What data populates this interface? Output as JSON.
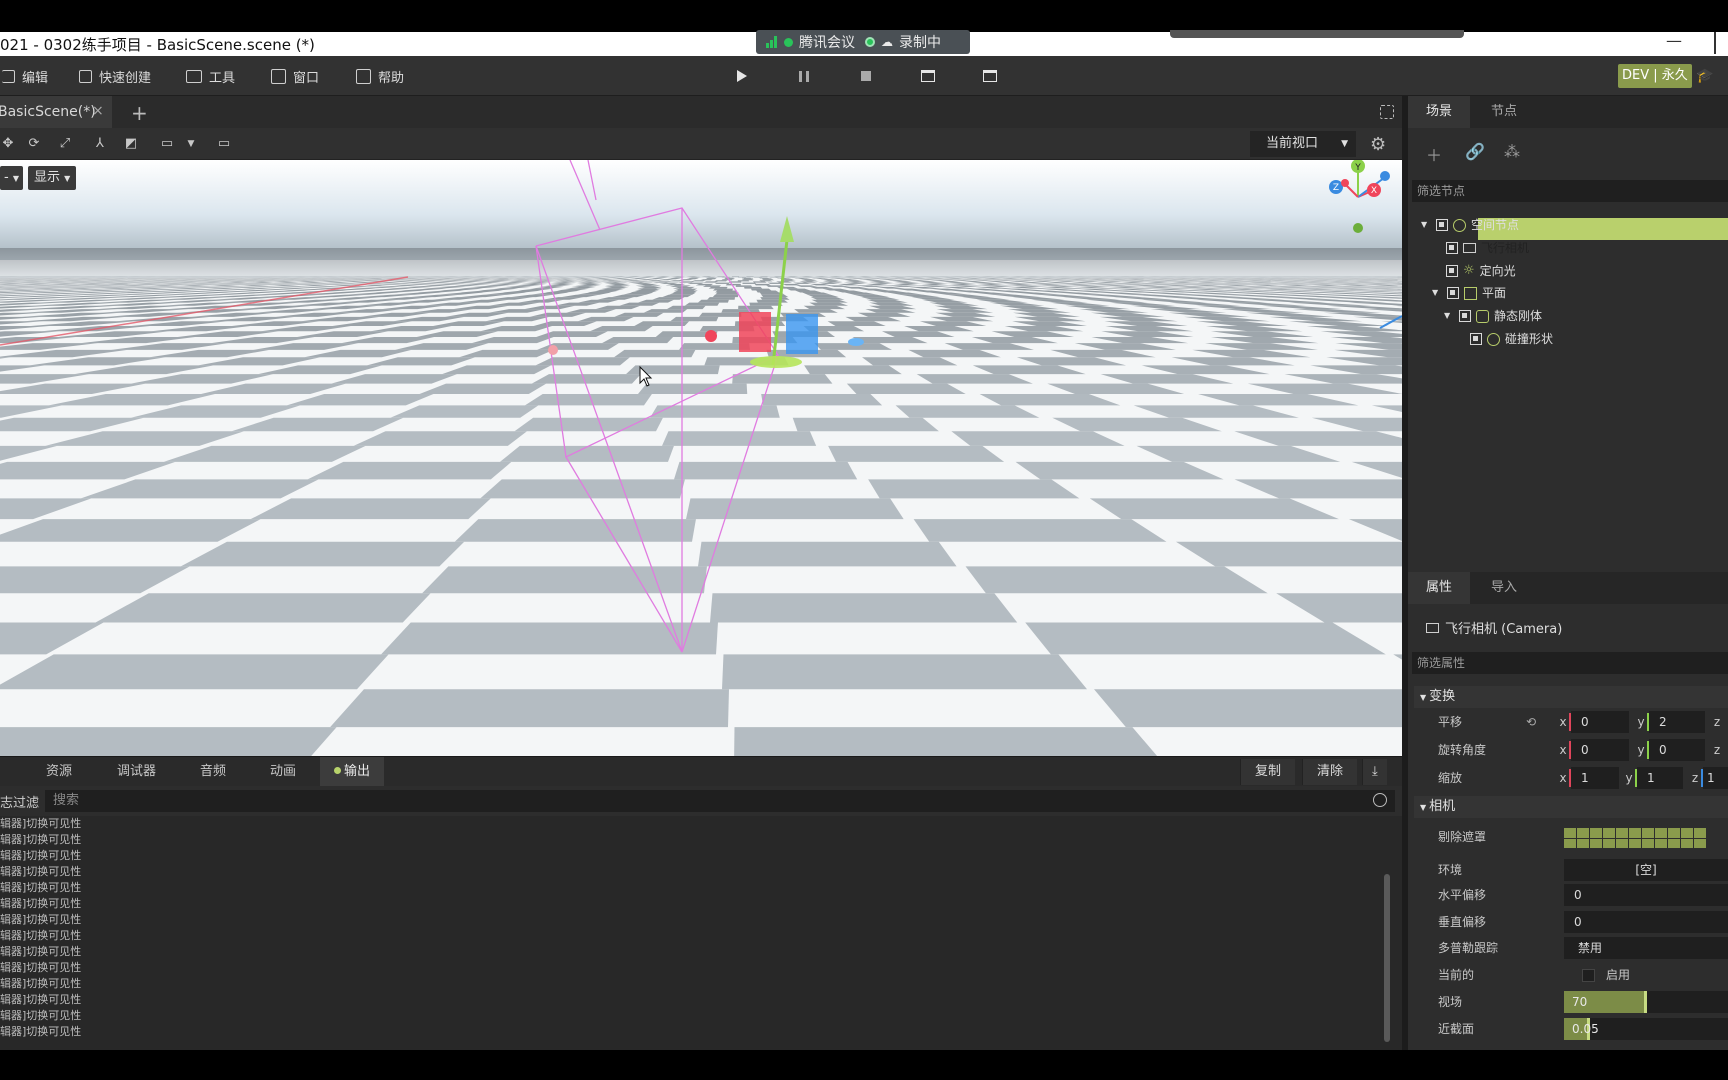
{
  "window": {
    "title": "021 - 0302练手项目 - BasicScene.scene (*)"
  },
  "meeting": {
    "app": "腾讯会议",
    "recording": "录制中"
  },
  "menu": {
    "items": [
      "编辑",
      "快速创建",
      "工具",
      "窗口",
      "帮助"
    ]
  },
  "badge": "DEV | 永久",
  "document_tab": {
    "label": "BasicScene(*)",
    "close": "×",
    "add": "+"
  },
  "viewport": {
    "view_select": "当前视口",
    "btn_display": "显示",
    "btn_left": "-"
  },
  "gizmo": {
    "y": "Y",
    "z": "Z",
    "x": "X"
  },
  "bottom": {
    "tabs": [
      "资源",
      "调试器",
      "音频",
      "动画",
      "输出"
    ],
    "active_tab": "输出",
    "copy": "复制",
    "clear": "清除",
    "filter_label": "志过滤",
    "search_placeholder": "搜索",
    "log_lines": [
      "辑器]切换可见性",
      "辑器]切换可见性",
      "辑器]切换可见性",
      "辑器]切换可见性",
      "辑器]切换可见性",
      "辑器]切换可见性",
      "辑器]切换可见性",
      "辑器]切换可见性",
      "辑器]切换可见性",
      "辑器]切换可见性",
      "辑器]切换可见性",
      "辑器]切换可见性",
      "辑器]切换可见性",
      "辑器]切换可见性"
    ]
  },
  "scene_panel": {
    "tabs": [
      "场景",
      "节点"
    ],
    "filter_placeholder": "筛选节点",
    "nodes": [
      "空间节点",
      "飞行相机",
      "定向光",
      "平面",
      "静态刚体",
      "碰撞形状"
    ],
    "selected": "飞行相机"
  },
  "inspector": {
    "tabs": [
      "属性",
      "导入"
    ],
    "object": "飞行相机 (Camera)",
    "filter_placeholder": "筛选属性",
    "transform": {
      "header": "变换",
      "translate_label": "平移",
      "translate": {
        "x": "0",
        "y": "2",
        "z": "z"
      },
      "rotate_label": "旋转角度",
      "rotate": {
        "x": "0",
        "y": "0",
        "z": "z"
      },
      "scale_label": "缩放",
      "scale": {
        "x": "1",
        "y": "1",
        "z": "1"
      }
    },
    "camera": {
      "header": "相机",
      "cull_mask_label": "剔除遮罩",
      "environment_label": "环境",
      "environment": "[空]",
      "h_offset_label": "水平偏移",
      "h_offset": "0",
      "v_offset_label": "垂直偏移",
      "v_offset": "0",
      "doppler_label": "多普勒跟踪",
      "doppler": "禁用",
      "current_label": "当前的",
      "current": "启用",
      "fov_label": "视场",
      "fov": "70",
      "fov_fraction": 0.5,
      "near_label": "近截面",
      "near": "0.05",
      "near_fraction": 0.15
    }
  },
  "colors": {
    "accent": "#b9d06c",
    "x_axis": "#e0455b",
    "y_axis": "#8cd14a",
    "z_axis": "#3a8be0"
  }
}
